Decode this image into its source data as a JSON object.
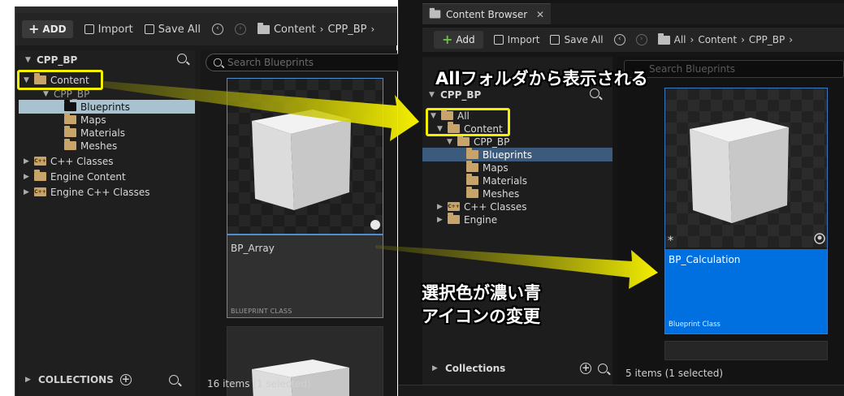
{
  "left": {
    "toolbar": {
      "add": "ADD",
      "import": "Import",
      "save_all": "Save All",
      "crumbs": [
        "Content",
        "CPP_BP"
      ]
    },
    "tree": {
      "root": "CPP_BP",
      "items": [
        "Content",
        "CPP_BP",
        "Blueprints",
        "Maps",
        "Materials",
        "Meshes",
        "C++ Classes",
        "Engine Content",
        "Engine C++ Classes"
      ]
    },
    "collections": "COLLECTIONS",
    "search_placeholder": "Search Blueprints",
    "asset": {
      "name": "BP_Array",
      "type": "BLUEPRINT CLASS"
    },
    "status": "16 items (1 selected)"
  },
  "right": {
    "tab": {
      "title": "Content Browser",
      "close": "✕"
    },
    "toolbar": {
      "add": "Add",
      "import": "Import",
      "save_all": "Save All",
      "crumbs": [
        "All",
        "Content",
        "CPP_BP"
      ]
    },
    "tree": {
      "root": "CPP_BP",
      "items": [
        "All",
        "Content",
        "CPP_BP",
        "Blueprints",
        "Maps",
        "Materials",
        "Meshes",
        "C++ Classes",
        "Engine"
      ]
    },
    "collections": "Collections",
    "search_placeholder": "Search Blueprints",
    "asset": {
      "name": "BP_Calculation",
      "type": "Blueprint Class"
    },
    "status": "5 items (1 selected)"
  },
  "annotations": {
    "all_folder": "Allフォルダから表示される",
    "selection_color": "選択色が濃い青",
    "icon_change": "アイコンの変更"
  },
  "colors": {
    "highlight": "#f5f000",
    "selection_new": "#0070e0",
    "selection_old": "#a9c2cf",
    "folder": "#c9a46a"
  }
}
